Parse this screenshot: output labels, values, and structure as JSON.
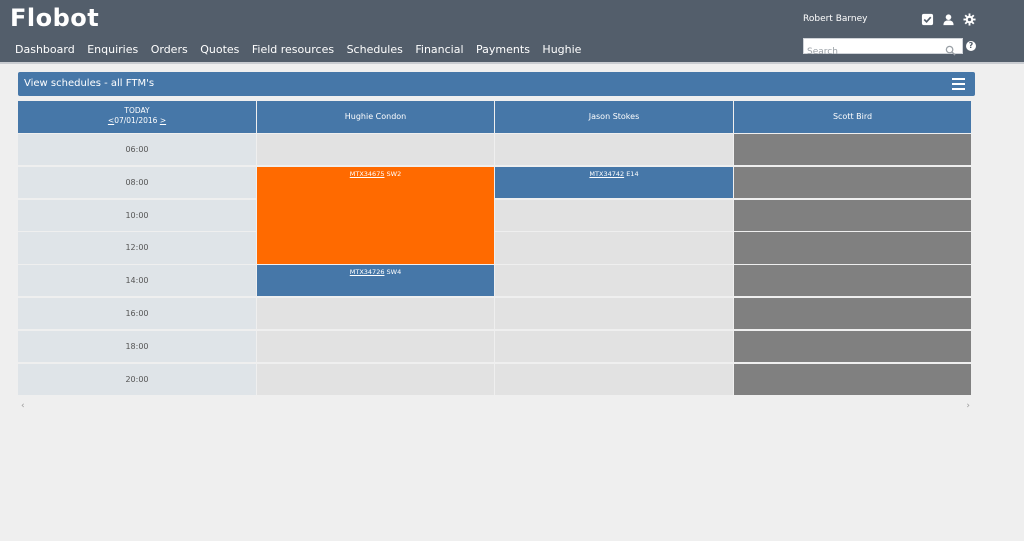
{
  "app": {
    "title": "Flobot"
  },
  "nav": [
    "Dashboard",
    "Enquiries",
    "Orders",
    "Quotes",
    "Field resources",
    "Schedules",
    "Financial",
    "Payments",
    "Hughie"
  ],
  "user": {
    "name": "Robert Barney"
  },
  "icons": [
    "checkbox-icon",
    "user-icon",
    "gear-icon",
    "search-icon",
    "help-icon",
    "menu-icon"
  ],
  "search": {
    "placeholder": "Search",
    "value": ""
  },
  "help": {
    "label": "?"
  },
  "panel": {
    "title": "View schedules - all FTM's"
  },
  "schedule": {
    "today_label": "TODAY",
    "prev": "<",
    "date": "07/01/2016",
    "next": ">",
    "resources": [
      "Hughie Condon",
      "Jason Stokes",
      "Scott Bird"
    ],
    "times": [
      "06:00",
      "08:00",
      "10:00",
      "12:00",
      "14:00",
      "16:00",
      "18:00",
      "20:00"
    ],
    "jobs": [
      {
        "ref": "MTX34675",
        "suffix": "SW2",
        "resource": 0,
        "start": 1,
        "span": 3,
        "color": "#ff6a00"
      },
      {
        "ref": "MTX34742",
        "suffix": "E14",
        "resource": 1,
        "start": 1,
        "span": 1,
        "color": "#4677a8"
      },
      {
        "ref": "MTX34726",
        "suffix": "SW4",
        "resource": 0,
        "start": 4,
        "span": 1,
        "color": "#4677a8"
      }
    ],
    "unavailable_resources": [
      2
    ]
  },
  "scroll": {
    "left": "‹",
    "right": "›"
  },
  "colors": {
    "header": "#535e6b",
    "accent": "#4677a8",
    "orange": "#ff6a00",
    "slot": "#e2e2e2",
    "off": "#808080",
    "time_cell": "#dfe4e8"
  }
}
